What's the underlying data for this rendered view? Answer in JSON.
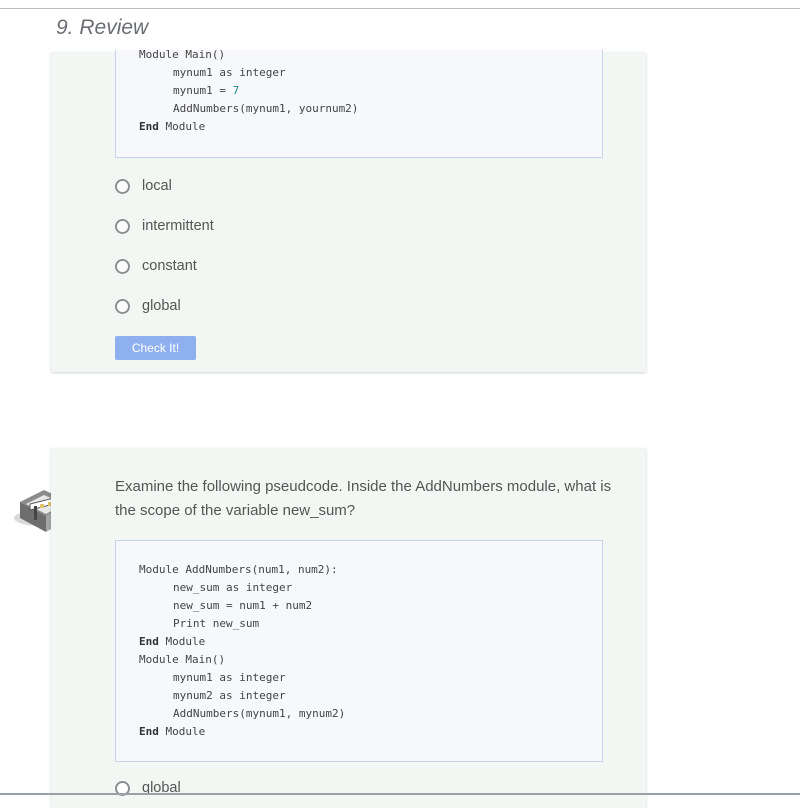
{
  "header": {
    "title": "9. Review"
  },
  "question1": {
    "code_lines": [
      {
        "text": "Module Main()",
        "indent": 0
      },
      {
        "text": "mynum1 as integer",
        "indent": 1
      },
      {
        "pre": "mynum1 = ",
        "num": "7",
        "indent": 1
      },
      {
        "text": "AddNumbers(mynum1, yournum2)",
        "indent": 1
      },
      {
        "kw": "End",
        "rest": " Module",
        "indent": 0
      }
    ],
    "options": [
      "local",
      "intermittent",
      "constant",
      "global"
    ],
    "check_label": "Check It!"
  },
  "question2": {
    "prompt": "Examine the following pseudcode. Inside the AddNumbers module, what is the scope of the variable new_sum?",
    "code_lines": [
      {
        "text": "Module AddNumbers(num1, num2):",
        "indent": 0
      },
      {
        "text": "new_sum as integer",
        "indent": 1
      },
      {
        "text": "new_sum = num1 + num2",
        "indent": 1
      },
      {
        "text": "Print new_sum",
        "indent": 1
      },
      {
        "kw": "End",
        "rest": " Module",
        "indent": 0
      },
      {
        "text": "Module Main()",
        "indent": 0
      },
      {
        "text": "mynum1 as integer",
        "indent": 1
      },
      {
        "text": "mynum2 as integer",
        "indent": 1
      },
      {
        "text": "AddNumbers(mynum1, mynum2)",
        "indent": 1
      },
      {
        "kw": "End",
        "rest": " Module",
        "indent": 0
      }
    ],
    "options": [
      "global"
    ]
  },
  "icons": {
    "question_icon": "hurdle-icon"
  }
}
